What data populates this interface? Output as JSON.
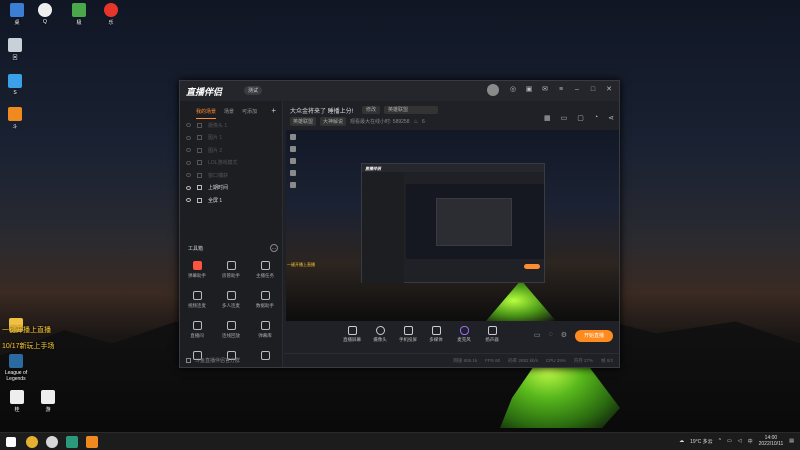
{
  "desktop": {
    "top_icons": [
      {
        "label": "桌",
        "icon": "app-icon"
      },
      {
        "label": "Q",
        "icon": "qq-icon"
      },
      {
        "label": "极",
        "icon": "app-icon"
      },
      {
        "label": "乐",
        "icon": "app-icon"
      }
    ],
    "left_icons": [
      {
        "label": "回",
        "icon": "recycle-bin-icon"
      },
      {
        "label": "S",
        "icon": "app-icon"
      },
      {
        "label": "斗",
        "icon": "app-icon"
      }
    ],
    "overlay_text_1": "一键开播上直播",
    "overlay_text_2": "10/17新玩上手场",
    "lol_label": "League of Legends",
    "bottom_icons": [
      {
        "label": "桂",
        "icon": "file-icon"
      },
      {
        "label": "游",
        "icon": "file-icon"
      }
    ]
  },
  "app": {
    "logo": "直播伴侣",
    "version_badge": "测试",
    "sidebar": {
      "tabs": [
        "我的场景",
        "场景",
        "可添加"
      ],
      "plus": "+",
      "scenes": [
        {
          "label": "摄像头 1",
          "on": false
        },
        {
          "label": "图片 1",
          "on": false
        },
        {
          "label": "图片 2",
          "on": false
        },
        {
          "label": "LOL游戏模式",
          "on": false
        },
        {
          "label": "窗口捕获",
          "on": false
        },
        {
          "label": "上期时间",
          "on": true
        },
        {
          "label": "全屏 1",
          "on": true
        }
      ],
      "tools_title": "工具箱",
      "tools_more": "…",
      "tools": [
        {
          "label": "弹幕助手",
          "hot": true
        },
        {
          "label": "房管助手",
          "hot": false
        },
        {
          "label": "主播任务",
          "hot": false
        },
        {
          "label": "视频连麦",
          "hot": false
        },
        {
          "label": "多人连麦",
          "hot": false
        },
        {
          "label": "数据助手",
          "hot": false
        },
        {
          "label": "直播间",
          "hot": false
        },
        {
          "label": "连线回放",
          "hot": false
        },
        {
          "label": "弹幕库",
          "hot": false
        },
        {
          "label": "",
          "hot": false
        },
        {
          "label": "",
          "hot": false
        },
        {
          "label": "",
          "hot": false
        }
      ],
      "footer": "斗鱼直播伴侣官方群"
    },
    "top_info": {
      "title": "大众金将来了 睡播上分!",
      "pill1": "修改",
      "pill2": "英雄联盟",
      "chip1": "英雄联盟",
      "chip2": "大神解说",
      "stats": "观看最大在线小时: 589258",
      "fans": "6"
    },
    "preview": {
      "inner_logo": "直播伴侣",
      "overlay_text": "一键开播上直播"
    },
    "controls": [
      {
        "label": "直播屏幕"
      },
      {
        "label": "摄像头"
      },
      {
        "label": "手机投屏"
      },
      {
        "label": "多媒体"
      },
      {
        "label": "麦克风"
      },
      {
        "label": "扬声器"
      }
    ],
    "live_button": "开始直播",
    "status": [
      "网速 655.1k",
      "FPS 60",
      "码率 2852 kb/s",
      "CPU 29%",
      "内存 27%",
      "帧 0/2"
    ]
  },
  "taskbar": {
    "weather": "19°C 多云",
    "time": "14:00",
    "date": "2022/10/11"
  }
}
